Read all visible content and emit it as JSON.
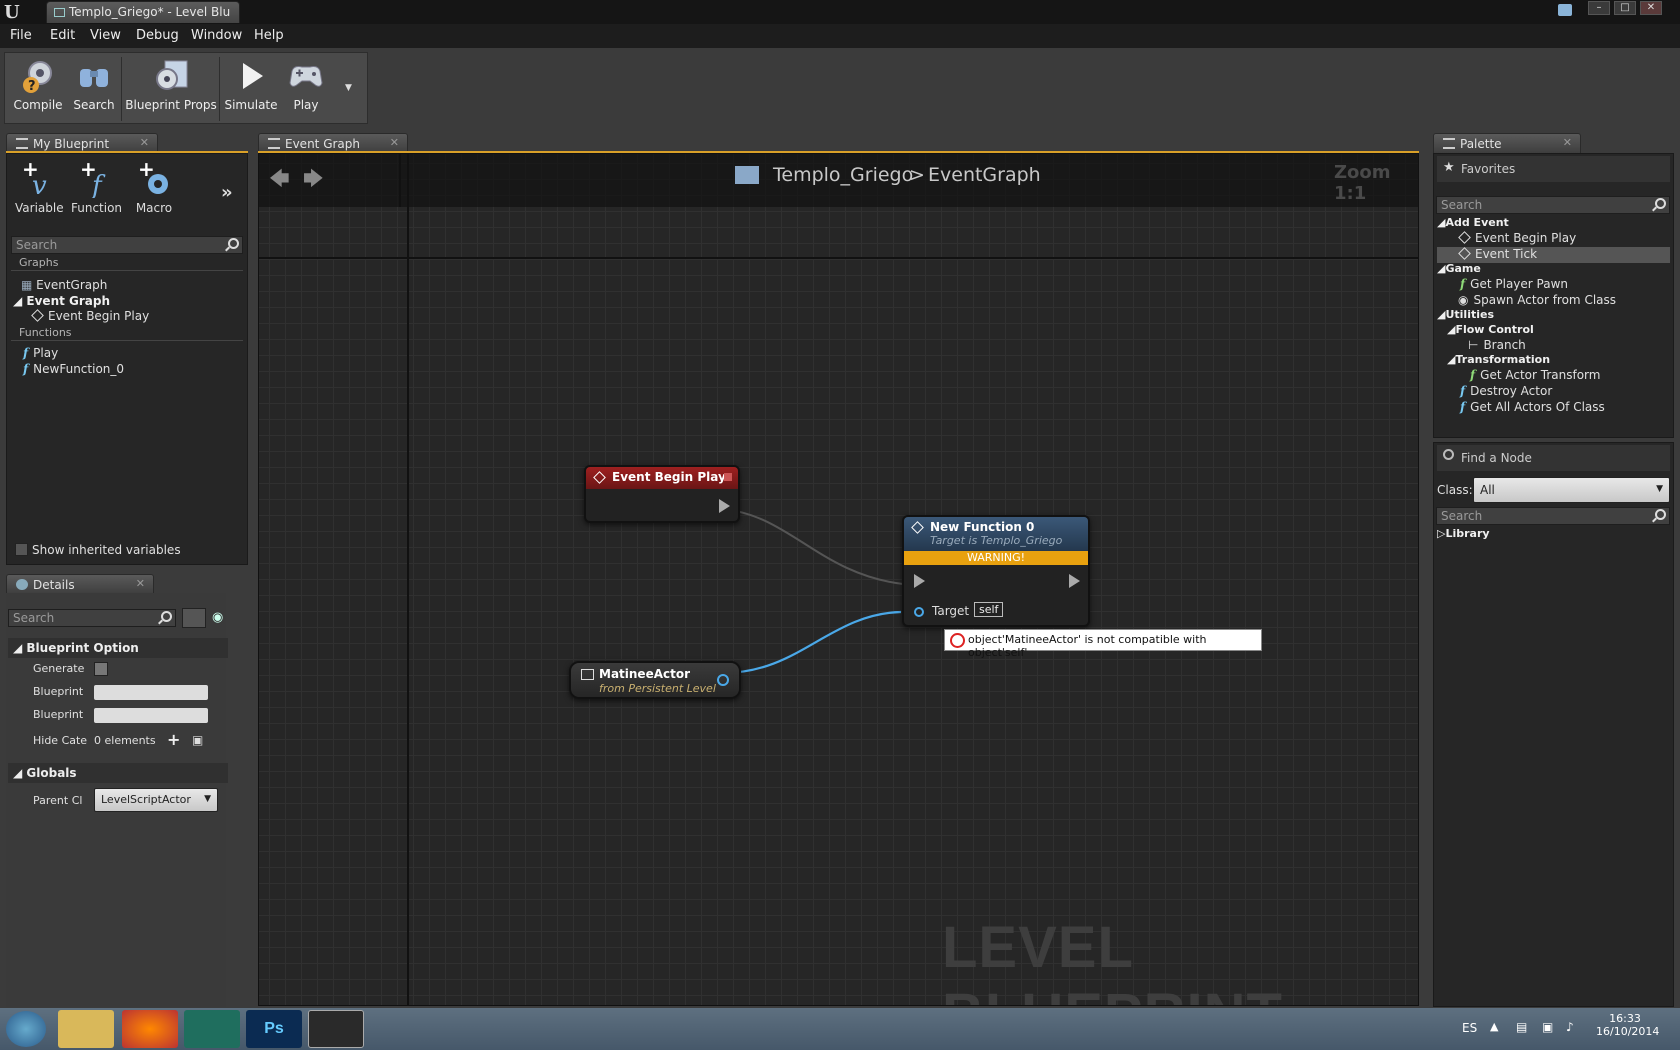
{
  "window": {
    "tab_title": "Templo_Griego* - Level Blu"
  },
  "menu": [
    "File",
    "Edit",
    "View",
    "Debug",
    "Window",
    "Help"
  ],
  "toolbar": {
    "compile": "Compile",
    "search": "Search",
    "blueprint_props": "Blueprint Props",
    "simulate": "Simulate",
    "play": "Play"
  },
  "mybp": {
    "tab": "My Blueprint",
    "actions": {
      "variable": "Variable",
      "function": "Function",
      "macro": "Macro"
    },
    "search_placeholder": "Search",
    "graphs_header": "Graphs",
    "event_graph": "EventGraph",
    "event_graph_cat": "Event Graph",
    "event_begin_play": "Event Begin Play",
    "functions_header": "Functions",
    "functions": [
      "Play",
      "NewFunction_0"
    ],
    "show_inherited": "Show inherited variables"
  },
  "details": {
    "tab": "Details",
    "search_placeholder": "Search",
    "blueprint_option": "Blueprint Option",
    "row_generate": "Generate",
    "row_blueprint1": "Blueprint",
    "row_blueprint2": "Blueprint",
    "row_hide": "Hide Cate",
    "hide_value": "0 elements",
    "globals": "Globals",
    "parent_label": "Parent Cl",
    "parent_value": "LevelScriptActor"
  },
  "graph": {
    "tab": "Event Graph",
    "crumb_root": "Templo_Griego",
    "crumb_sep": ">",
    "crumb_leaf": "EventGraph",
    "zoom": "Zoom 1:1",
    "watermark": "LEVEL BLUEPRINT",
    "node_begin": "Event Begin Play",
    "node_fn_title": "New Function 0",
    "node_fn_sub": "Target is Templo_Griego",
    "node_fn_warning": "WARNING!",
    "node_fn_target": "Target",
    "node_fn_self": "self",
    "error_msg": "object'MatineeActor' is not compatible with object'self'",
    "node_matinee": "MatineeActor",
    "node_matinee_sub": "from Persistent Level"
  },
  "palette": {
    "tab": "Palette",
    "favorites": "Favorites",
    "search_placeholder": "Search",
    "add_event": "Add Event",
    "event_begin_play": "Event Begin Play",
    "event_tick": "Event Tick",
    "game": "Game",
    "get_player_pawn": "Get Player Pawn",
    "spawn_actor": "Spawn Actor from Class",
    "utilities": "Utilities",
    "flow_control": "Flow Control",
    "branch": "Branch",
    "transformation": "Transformation",
    "get_actor_transform": "Get Actor Transform",
    "destroy_actor": "Destroy Actor",
    "get_all_actors": "Get All Actors Of Class",
    "find_node": "Find a Node",
    "class_label": "Class:",
    "class_value": "All",
    "library": "Library"
  },
  "taskbar": {
    "lang": "ES",
    "time": "16:33",
    "date": "16/10/2014"
  }
}
